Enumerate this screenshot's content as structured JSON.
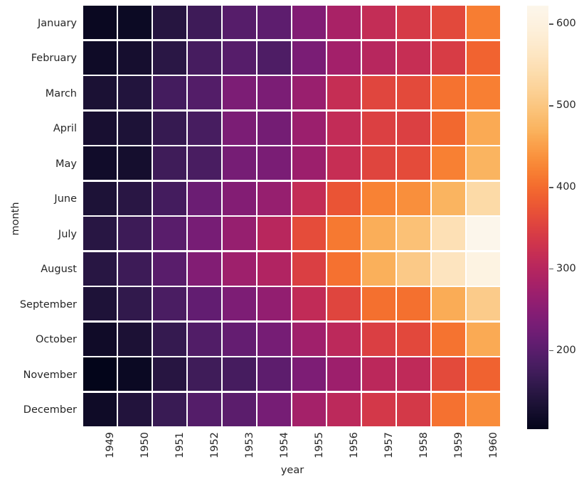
{
  "chart_data": {
    "type": "heatmap",
    "title": "",
    "xlabel": "year",
    "ylabel": "month",
    "x_tick_labels": [
      "1949",
      "1950",
      "1951",
      "1952",
      "1953",
      "1954",
      "1955",
      "1956",
      "1957",
      "1958",
      "1959",
      "1960"
    ],
    "y_tick_labels": [
      "January",
      "February",
      "March",
      "April",
      "May",
      "June",
      "July",
      "August",
      "September",
      "October",
      "November",
      "December"
    ],
    "colormap": "rocket",
    "colorbar": {
      "position": "right",
      "ticks": [
        600,
        500,
        400,
        300,
        200
      ],
      "tick_labels": [
        "600",
        "500",
        "400",
        "300",
        "200"
      ],
      "vmin": 104,
      "vmax": 622
    },
    "grid": false,
    "cell_gap_color": "#ffffff",
    "values": [
      [
        112,
        115,
        145,
        171,
        196,
        204,
        242,
        284,
        315,
        340,
        360,
        417
      ],
      [
        118,
        126,
        150,
        180,
        196,
        188,
        233,
        277,
        301,
        318,
        342,
        391
      ],
      [
        132,
        141,
        178,
        193,
        236,
        235,
        267,
        317,
        356,
        362,
        406,
        419
      ],
      [
        129,
        135,
        163,
        181,
        235,
        227,
        269,
        313,
        348,
        348,
        396,
        461
      ],
      [
        121,
        125,
        172,
        183,
        229,
        234,
        270,
        318,
        355,
        363,
        420,
        472
      ],
      [
        135,
        149,
        178,
        218,
        243,
        264,
        315,
        374,
        422,
        435,
        472,
        535
      ],
      [
        148,
        170,
        199,
        230,
        264,
        302,
        364,
        413,
        465,
        491,
        548,
        622
      ],
      [
        148,
        170,
        199,
        242,
        272,
        293,
        347,
        405,
        467,
        505,
        559,
        606
      ],
      [
        136,
        158,
        184,
        209,
        237,
        259,
        312,
        355,
        404,
        404,
        463,
        508
      ],
      [
        119,
        133,
        162,
        191,
        211,
        229,
        274,
        306,
        347,
        359,
        407,
        461
      ],
      [
        104,
        114,
        146,
        172,
        180,
        203,
        237,
        271,
        305,
        310,
        362,
        390
      ],
      [
        118,
        140,
        166,
        194,
        201,
        229,
        278,
        306,
        336,
        337,
        405,
        432
      ]
    ]
  },
  "axes": {
    "ylabel": "month",
    "xlabel": "year"
  }
}
